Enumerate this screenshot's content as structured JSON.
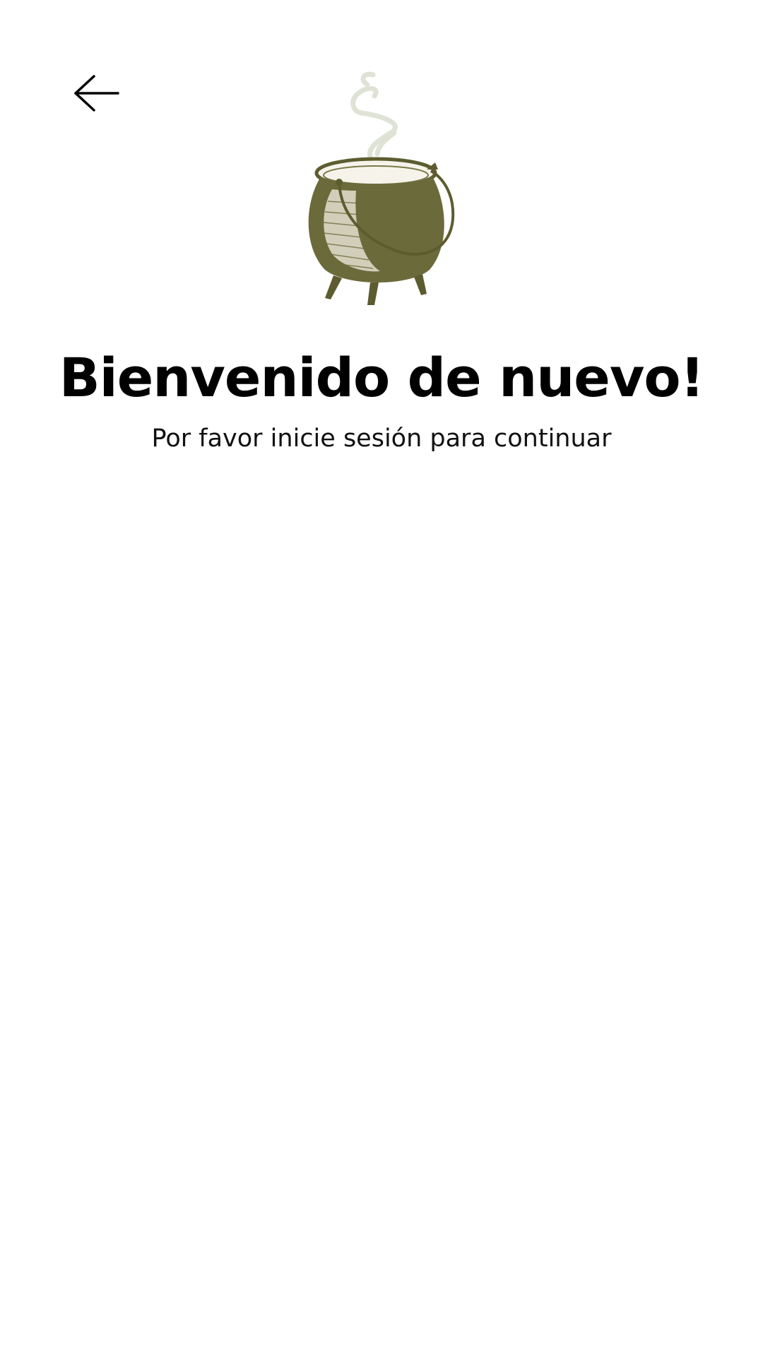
{
  "header": {
    "back_icon": "arrow-left-icon"
  },
  "hero": {
    "image": "cauldron-illustration",
    "steam_color": "#dfe3d6",
    "pot_color": "#6b6a3a"
  },
  "welcome": {
    "title": "Bienvenido de nuevo!",
    "subtitle": "Por favor inicie sesión para continuar"
  }
}
